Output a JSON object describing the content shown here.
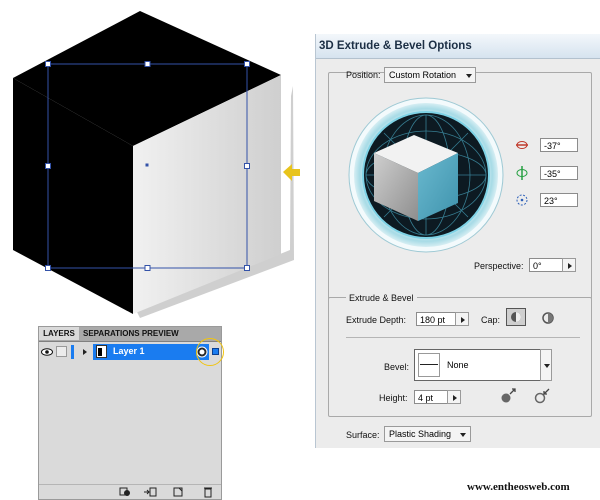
{
  "dialog": {
    "title": "3D Extrude & Bevel Options",
    "position_label": "Position:",
    "position_value": "Custom Rotation",
    "rotation_x": "-37°",
    "rotation_y": "-35°",
    "rotation_z": "23°",
    "perspective_label": "Perspective:",
    "perspective_value": "0°",
    "extrude_bevel_header": "Extrude & Bevel",
    "extrude_depth_label": "Extrude Depth:",
    "extrude_depth_value": "180 pt",
    "cap_label": "Cap:",
    "bevel_label": "Bevel:",
    "bevel_value": "None",
    "height_label": "Height:",
    "height_value": "4 pt",
    "surface_label": "Surface:",
    "surface_value": "Plastic Shading"
  },
  "layers": {
    "tab_layers": "LAYERS",
    "tab_separations": "SEPARATIONS PREVIEW",
    "layer_name": "Layer 1",
    "accent_color": "#1a7cf0",
    "highlight_color": "#f1c40f"
  },
  "watermark": "www.entheosweb.com",
  "colors": {
    "cube_front": "#d8d8d8",
    "cube_dark": "#000000",
    "selection": "#3352a8",
    "arrow": "#e8c41c",
    "dial_teal": "#5aaec4"
  }
}
